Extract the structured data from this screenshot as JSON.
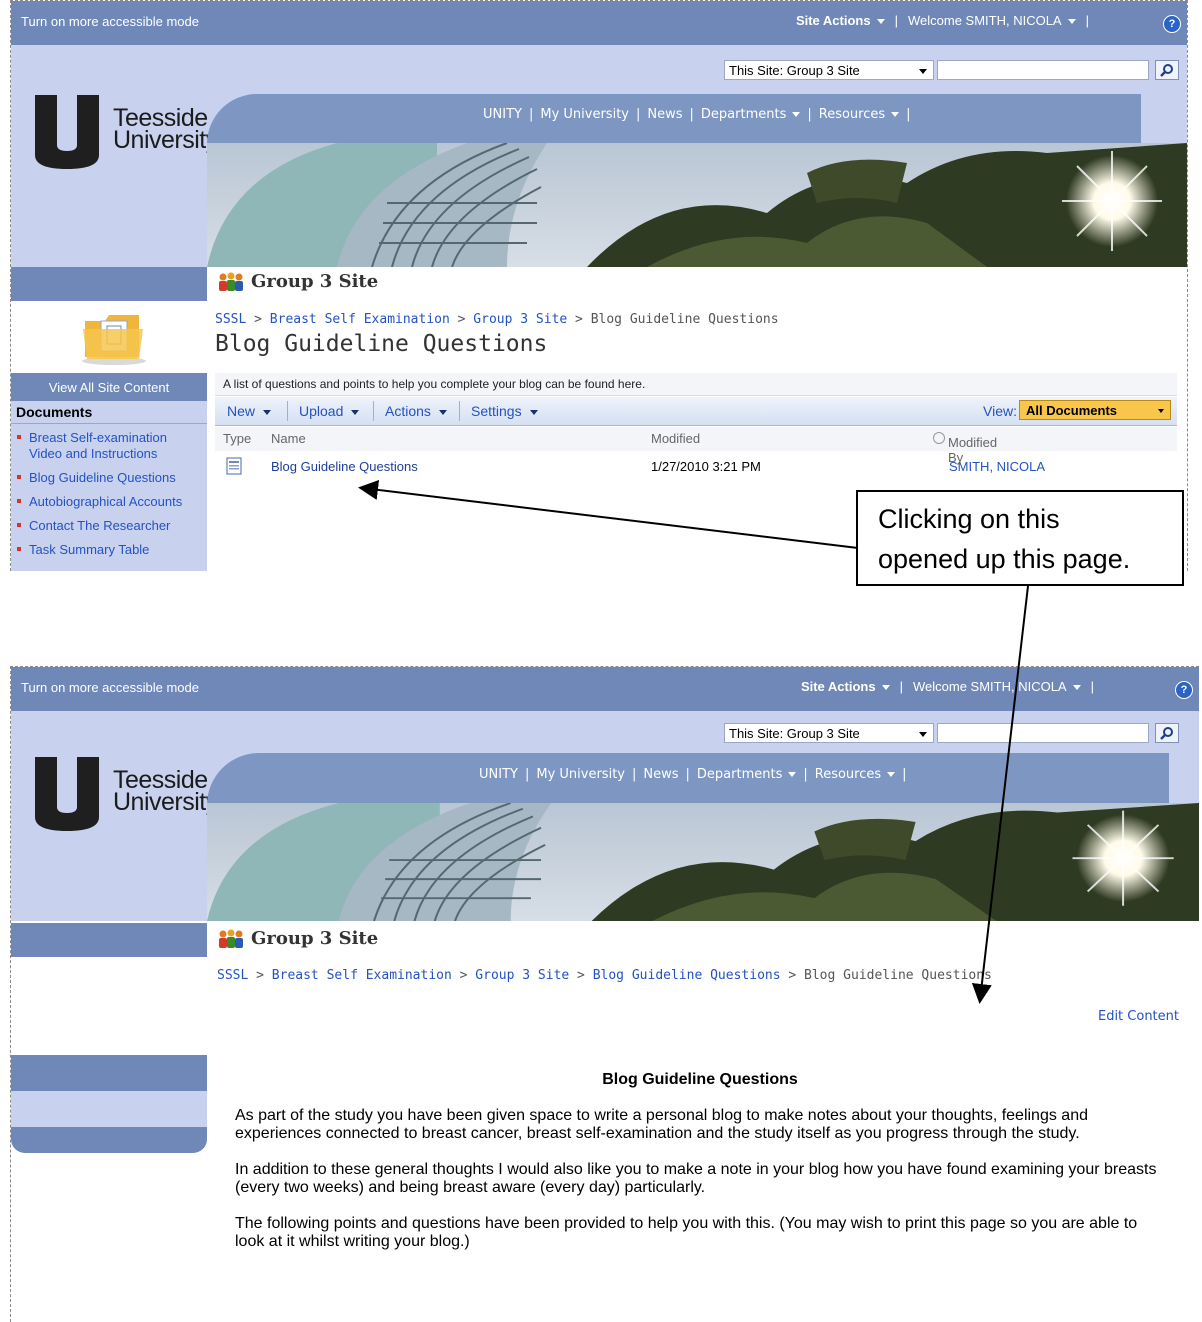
{
  "topbar": {
    "accessible_mode": "Turn on more accessible mode",
    "site_actions": "Site Actions",
    "welcome": "Welcome SMITH, NICOLA",
    "help": "?"
  },
  "search": {
    "scope": "This Site: Group 3 Site",
    "query": ""
  },
  "logo": {
    "line1": "Teesside",
    "line2": "University"
  },
  "nav": {
    "unity": "UNITY",
    "my_university": "My University",
    "news": "News",
    "departments": "Departments",
    "resources": "Resources"
  },
  "site_title": "Group 3 Site",
  "top_page": {
    "breadcrumb": [
      "SSSL",
      "Breast Self Examination",
      "Group 3 Site",
      "Blog Guideline Questions"
    ],
    "title": "Blog Guideline Questions",
    "description": "A list of questions and points to help you complete your blog can be found here.",
    "toolbar": {
      "new": "New",
      "upload": "Upload",
      "actions": "Actions",
      "settings": "Settings",
      "view_label": "View:",
      "view_value": "All Documents"
    },
    "columns": {
      "type": "Type",
      "name": "Name",
      "modified": "Modified",
      "modified_by": "Modified By"
    },
    "row": {
      "name": "Blog Guideline Questions",
      "modified": "1/27/2010 3:21 PM",
      "modified_by": "SMITH, NICOLA"
    }
  },
  "leftnav": {
    "view_all": "View All Site Content",
    "heading": "Documents",
    "items": [
      "Breast Self-examination Video and Instructions",
      "Blog Guideline Questions",
      "Autobiographical Accounts",
      "Contact The Researcher",
      "Task Summary Table"
    ]
  },
  "callout": {
    "line1": "Clicking on this",
    "line2": "opened up this page."
  },
  "bottom_page": {
    "breadcrumb": [
      "SSSL",
      "Breast Self Examination",
      "Group 3 Site",
      "Blog Guideline Questions",
      "Blog Guideline Questions"
    ],
    "edit_content": "Edit Content",
    "heading": "Blog Guideline Questions",
    "paragraphs": [
      "As part of the study you have been given space to write a personal blog to make notes about your thoughts, feelings and experiences connected to breast cancer, breast self-examination and the study itself as you progress through the study.",
      "In addition to these general thoughts I would also like you to make a note in your blog how you have found examining your breasts (every two weeks) and being breast aware (every day) particularly.",
      "The following points and questions have been provided to help you with this. (You may wish to print this page so you are able to look at it whilst writing your blog.)"
    ]
  },
  "colors": {
    "bar": "#6f88b8",
    "header_bg": "#c8d2ef",
    "link": "#2452c2",
    "view_select": "#f7c64a",
    "bullet": "#d8352a"
  }
}
